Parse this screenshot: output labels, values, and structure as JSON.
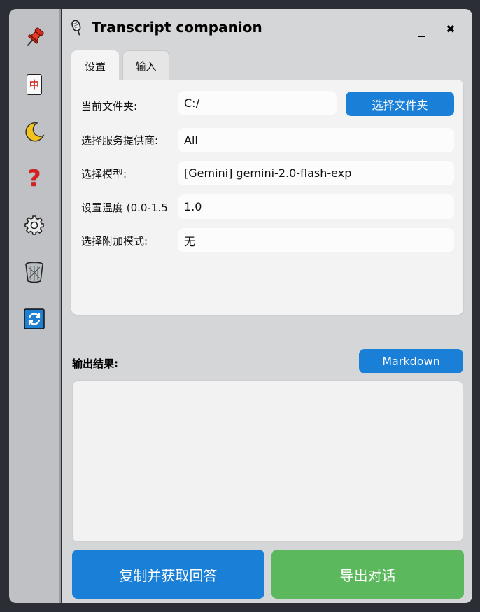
{
  "app": {
    "title": "Transcript companion",
    "title_icon": "microphone-icon",
    "minimize_label": "_",
    "close_label": "✖"
  },
  "sidebar": {
    "items": [
      {
        "icon": "pushpin-icon"
      },
      {
        "icon": "mahjong-zhong-icon",
        "glyph": "中"
      },
      {
        "icon": "crescent-moon-icon"
      },
      {
        "icon": "question-mark-icon",
        "glyph": "?"
      },
      {
        "icon": "gear-icon"
      },
      {
        "icon": "wastebasket-icon"
      },
      {
        "icon": "refresh-icon"
      }
    ]
  },
  "tabs": [
    {
      "label": "设置",
      "active": true
    },
    {
      "label": "输入",
      "active": false
    }
  ],
  "settings": {
    "folder_label": "当前文件夹:",
    "folder_value": "C:/",
    "choose_folder_button": "选择文件夹",
    "provider_label": "选择服务提供商:",
    "provider_value": "All",
    "model_label": "选择模型:",
    "model_value": "[Gemini] gemini-2.0-flash-exp",
    "temperature_label": "设置温度 (0.0-1.5",
    "temperature_value": "1.0",
    "append_mode_label": "选择附加模式:",
    "append_mode_value": "无"
  },
  "output": {
    "label": "输出结果:",
    "markdown_button": "Markdown",
    "content": ""
  },
  "actions": {
    "copy_button": "复制并获取回答",
    "export_button": "导出对话"
  },
  "colors": {
    "primary_blue": "#1a7fd6",
    "export_green": "#5cb85c",
    "background": "#2b2e34",
    "sidebar": "#bfc1c4",
    "panel": "#d5d6d8"
  }
}
